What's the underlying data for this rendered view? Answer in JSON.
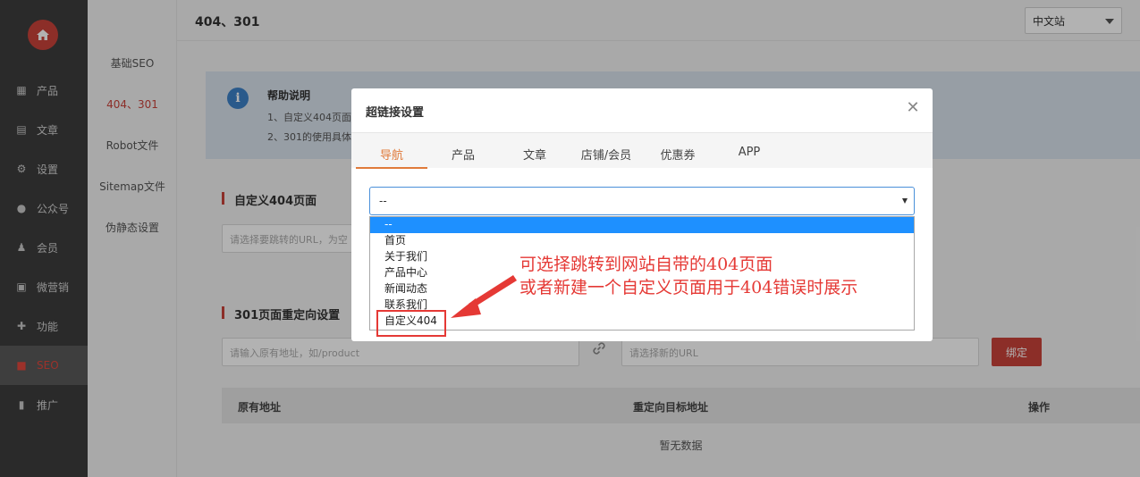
{
  "sidebar": {
    "items": [
      {
        "label": "产品",
        "icon": "grid-icon"
      },
      {
        "label": "文章",
        "icon": "document-icon"
      },
      {
        "label": "设置",
        "icon": "gear-icon"
      },
      {
        "label": "公众号",
        "icon": "wechat-icon"
      },
      {
        "label": "会员",
        "icon": "user-icon"
      },
      {
        "label": "微营销",
        "icon": "gift-icon"
      },
      {
        "label": "功能",
        "icon": "puzzle-icon"
      },
      {
        "label": "SEO",
        "icon": "seo-icon"
      },
      {
        "label": "推广",
        "icon": "chart-icon"
      }
    ],
    "active_index": 7
  },
  "subnav": {
    "items": [
      "基础SEO",
      "404、301",
      "Robot文件",
      "Sitemap文件",
      "伪静态设置"
    ],
    "active_index": 1
  },
  "header": {
    "title": "404、301",
    "language": "中文站"
  },
  "help": {
    "title": "帮助说明",
    "line1": "1、自定义404页面",
    "line2": "2、301的使用具体"
  },
  "section404": {
    "title": "自定义404页面",
    "placeholder": "请选择要跳转的URL，为空"
  },
  "section301": {
    "title": "301页面重定向设置",
    "old_placeholder": "请输入原有地址，如/product",
    "new_placeholder": "请选择新的URL",
    "bind_label": "绑定"
  },
  "table": {
    "headers": [
      "原有地址",
      "重定向目标地址",
      "操作"
    ],
    "empty_text": "暂无数据"
  },
  "modal": {
    "title": "超链接设置",
    "tabs": [
      "导航",
      "产品",
      "文章",
      "店铺/会员",
      "优惠券",
      "APP"
    ],
    "active_tab": 0,
    "select_value": "--",
    "options": [
      "--",
      "首页",
      "关于我们",
      "产品中心",
      "新闻动态",
      "联系我们",
      "自定义404"
    ],
    "selected_option": 0
  },
  "annotation": {
    "line1": "可选择跳转到网站自带的404页面",
    "line2": "或者新建一个自定义页面用于404错误时展示"
  },
  "colors": {
    "accent": "#c9423a",
    "tab_active": "#e07a3a",
    "annotation": "#e53935",
    "selected_option": "#1e90ff"
  }
}
